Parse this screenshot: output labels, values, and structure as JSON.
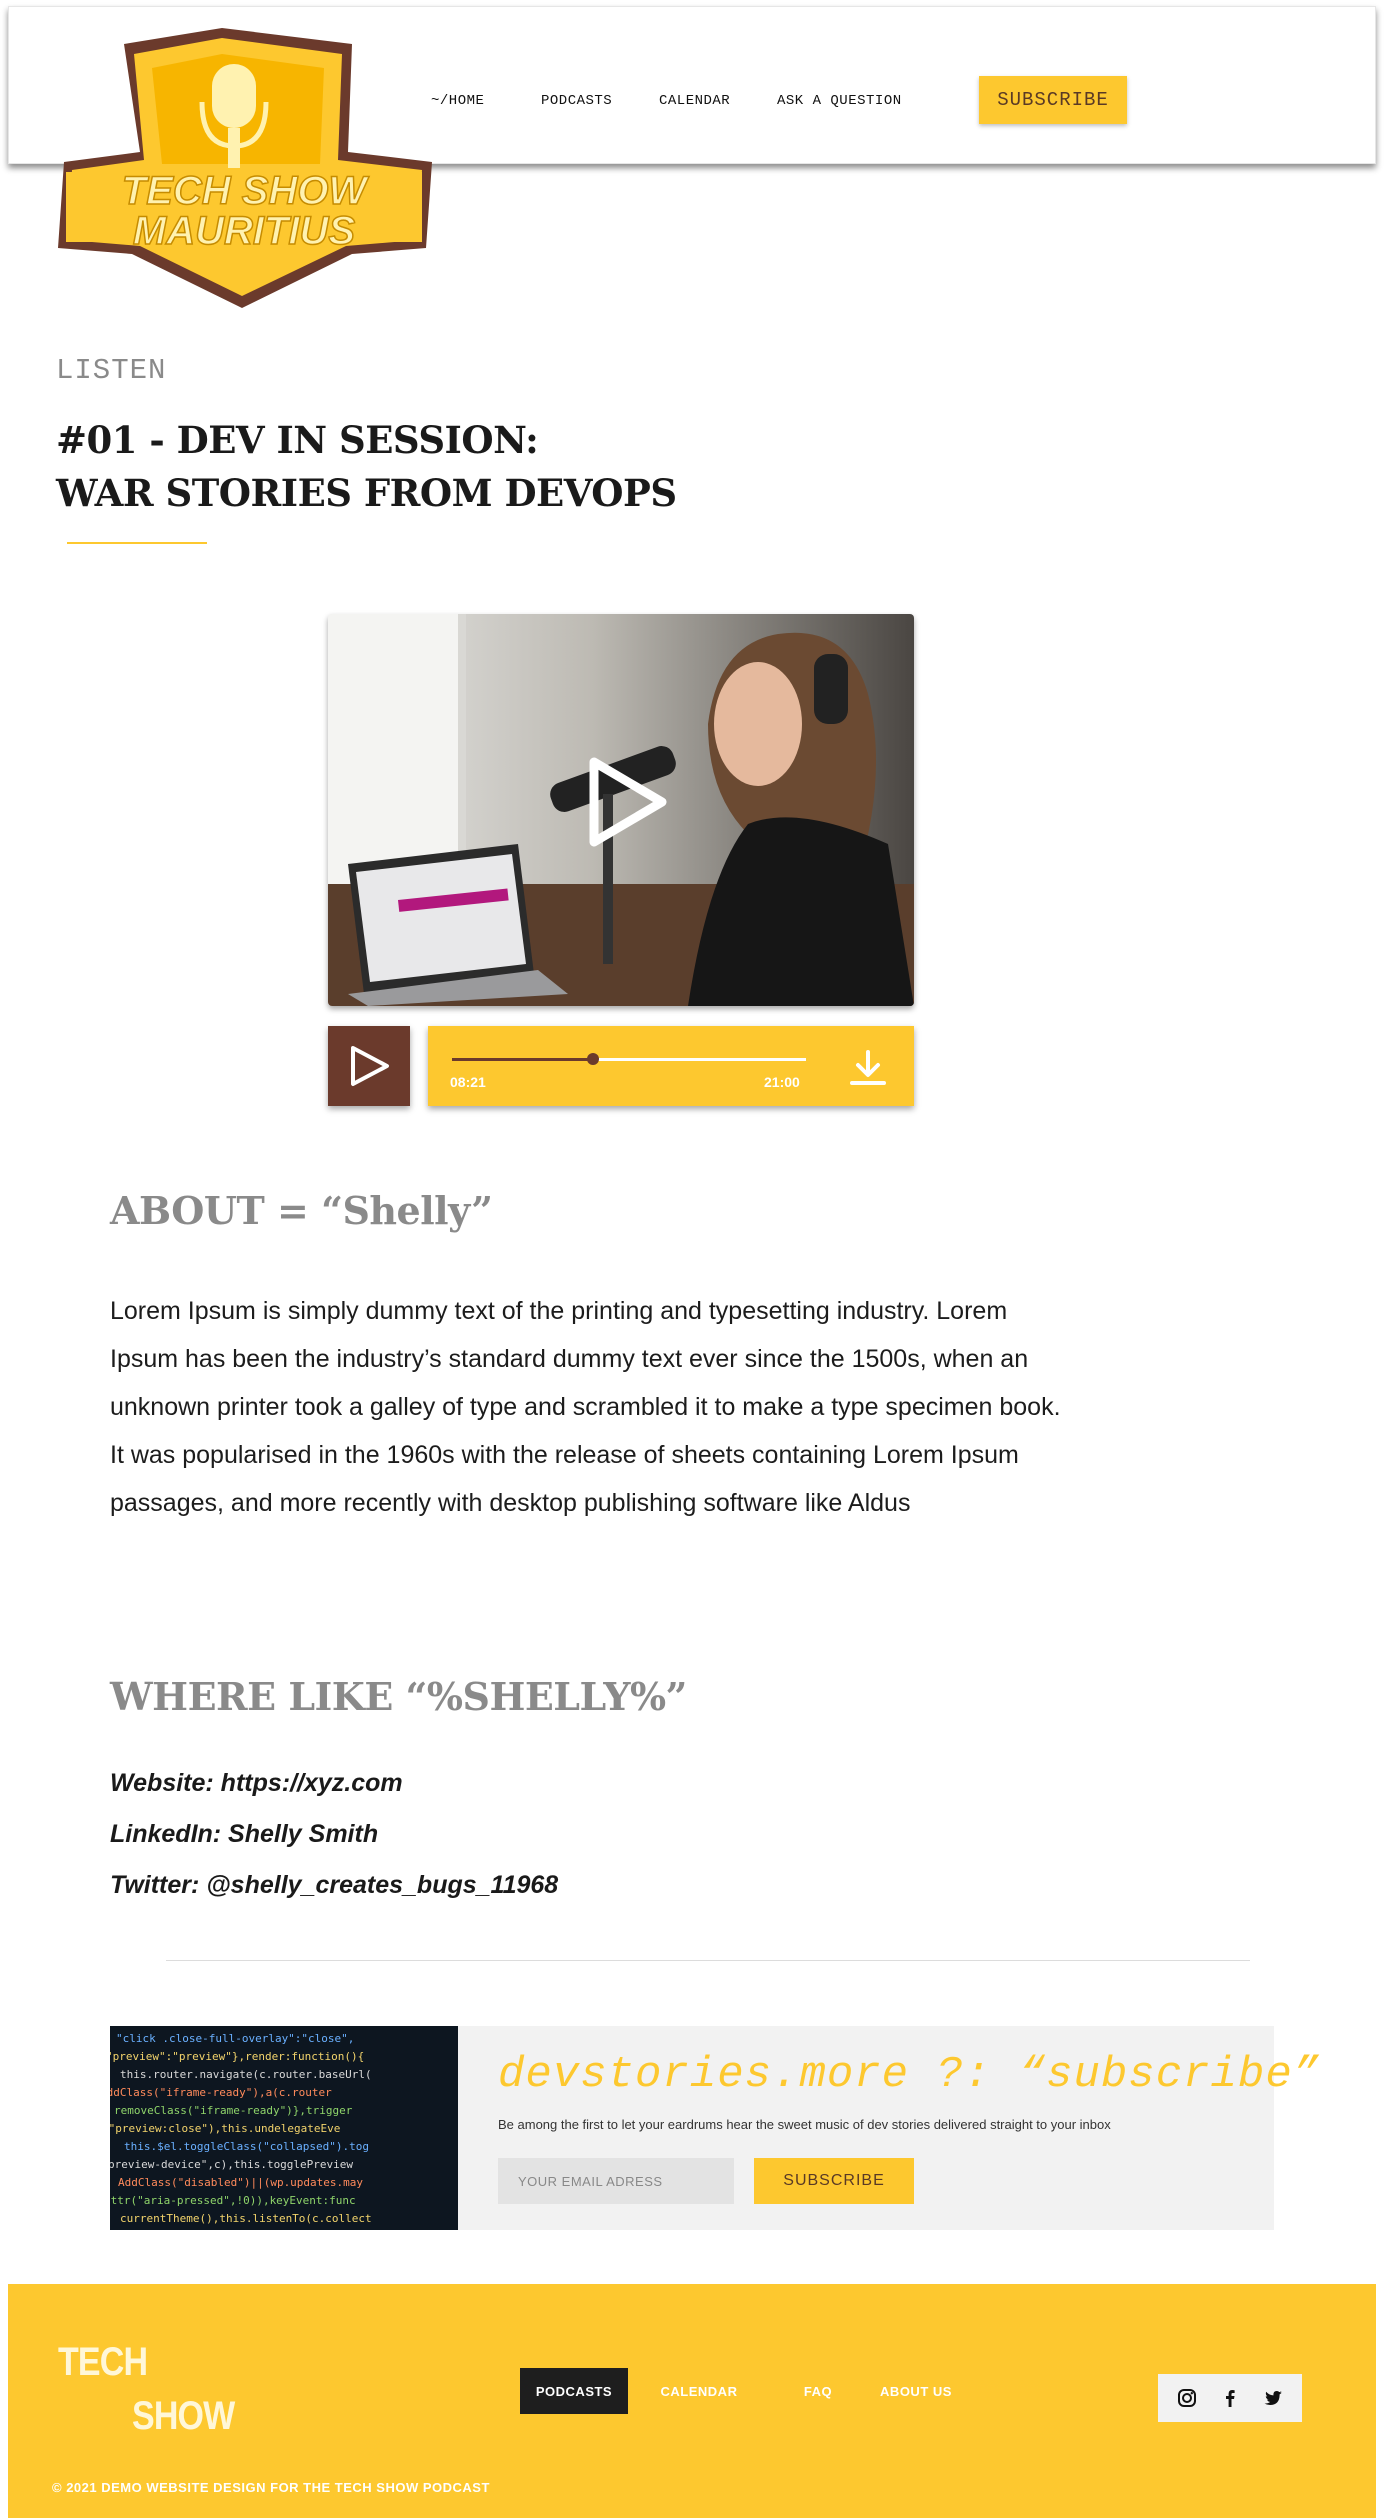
{
  "header": {
    "logo_line1": "TECH SHOW",
    "logo_line2": "MAURITIUS",
    "nav": [
      "~/HOME",
      "PODCASTS",
      "CALENDAR",
      "ASK A QUESTION"
    ],
    "subscribe_label": "SUBSCRIBE"
  },
  "episode": {
    "kicker": "LISTEN",
    "title_line1": "#01 - DEV IN SESSION:",
    "title_line2": "WAR STORIES FROM DEVOPS"
  },
  "player": {
    "current_time": "08:21",
    "duration": "21:00",
    "progress_fraction": 0.397
  },
  "about": {
    "heading": "ABOUT = “Shelly”",
    "paragraph1": "Lorem Ipsum is simply dummy text of the printing and typesetting industry. Lorem Ipsum has been the industry’s standard dummy text ever since the 1500s, when an unknown printer took a galley of type and scrambled it to make a type specimen book.",
    "paragraph2": "It was popularised in the 1960s with the release of sheets containing Lorem Ipsum passages, and more recently with desktop publishing software like Aldus"
  },
  "where": {
    "heading": "WHERE LIKE “%SHELLY%”",
    "website": "Website: https://xyz.com",
    "linkedin": "LinkedIn: Shelly Smith",
    "twitter": "Twitter: @shelly_creates_bugs_11968"
  },
  "newsletter": {
    "title": "devstories.more ?: “subscribe”",
    "subtitle": "Be among the first to let your eardrums hear the sweet music of dev stories delivered straight to your inbox",
    "email_placeholder": "YOUR EMAIL ADRESS",
    "button_label": "SUBSCRIBE"
  },
  "footer": {
    "logo_line1": "TECH",
    "logo_line2": "SHOW",
    "nav": [
      "PODCASTS",
      "CALENDAR",
      "FAQ",
      "ABOUT US"
    ],
    "active_nav": "PODCASTS",
    "social_icons": [
      "instagram-icon",
      "facebook-icon",
      "twitter-icon"
    ],
    "copyright": "© 2021 DEMO WEBSITE DESIGN FOR THE TECH SHOW PODCAST"
  },
  "colors": {
    "accent_yellow": "#fdc82f",
    "accent_brown": "#6b3a2c",
    "heading_gray": "#8a8a8a"
  }
}
